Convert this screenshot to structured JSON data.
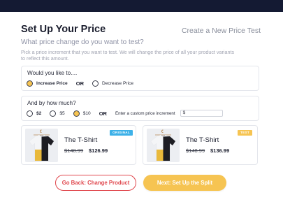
{
  "header": {
    "title": "Set Up Your Price",
    "create_link": "Create a New Price Test",
    "subtitle": "What price change do you want to test?",
    "description": "Pick a price increment that you want to test. We will change the price of all your product variants to reflect this amount."
  },
  "direction": {
    "question": "Would you like to....",
    "options": [
      {
        "label": "Increase Price",
        "selected": true
      },
      {
        "label": "Decrease Price",
        "selected": false
      }
    ],
    "or_label": "OR"
  },
  "amount": {
    "question": "And by how much?",
    "options": [
      {
        "label": "$2",
        "selected": false
      },
      {
        "label": "$5",
        "selected": false
      },
      {
        "label": "$10",
        "selected": true
      }
    ],
    "or_label": "OR",
    "custom_label": "Enter a custom price increment",
    "custom_value": "$"
  },
  "products": [
    {
      "badge": "ORIGINAL",
      "name": "The T-Shirt",
      "old_price": "$148.99",
      "new_price": "$126.99"
    },
    {
      "badge": "TEST",
      "name": "The T-Shirt",
      "old_price": "$148.99",
      "new_price": "$136.99"
    }
  ],
  "buttons": {
    "back": "Go Back: Change Product",
    "next": "Next: Set Up the Split"
  },
  "icons": [
    "tshirt-image"
  ],
  "colors": {
    "topbar": "#141a33",
    "accent_yellow": "#f6c452",
    "badge_blue": "#3db1e8",
    "back_red": "#e0484e"
  }
}
